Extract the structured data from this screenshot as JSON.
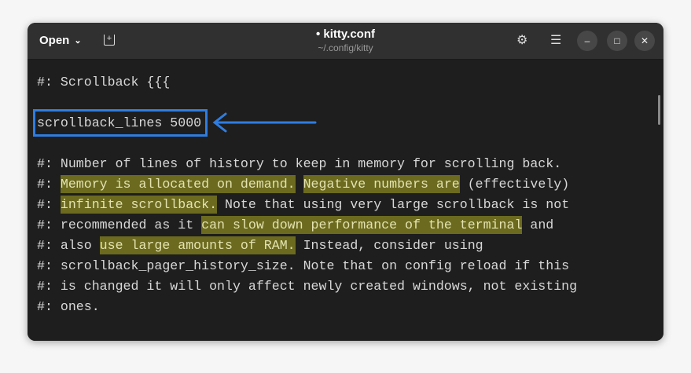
{
  "header": {
    "open_label": "Open",
    "title": "• kitty.conf",
    "subtitle": "~/.config/kitty"
  },
  "editor": {
    "lines": [
      [
        {
          "t": "#: Scrollback {{{",
          "h": false
        }
      ],
      [
        {
          "t": "scrollback_lines 5000",
          "h": false
        }
      ],
      [
        {
          "t": "#: Number of lines of history to keep in memory for scrolling back.",
          "h": false
        }
      ],
      [
        {
          "t": "#: ",
          "h": false
        },
        {
          "t": "Memory is allocated on demand.",
          "h": true
        },
        {
          "t": " ",
          "h": false
        },
        {
          "t": "Negative numbers are",
          "h": true
        },
        {
          "t": " (effectively)",
          "h": false
        }
      ],
      [
        {
          "t": "#: ",
          "h": false
        },
        {
          "t": "infinite scrollback.",
          "h": true
        },
        {
          "t": " Note that using very large scrollback is not",
          "h": false
        }
      ],
      [
        {
          "t": "#: recommended as it ",
          "h": false
        },
        {
          "t": "can slow down performance of the terminal",
          "h": true
        },
        {
          "t": " and",
          "h": false
        }
      ],
      [
        {
          "t": "#: also ",
          "h": false
        },
        {
          "t": "use large amounts of RAM.",
          "h": true
        },
        {
          "t": " Instead, consider using",
          "h": false
        }
      ],
      [
        {
          "t": "#: scrollback_pager_history_size. Note that on config reload if this",
          "h": false
        }
      ],
      [
        {
          "t": "#: is changed it will only affect newly created windows, not existing",
          "h": false
        }
      ],
      [
        {
          "t": "#: ones.",
          "h": false
        }
      ]
    ]
  },
  "colors": {
    "highlight": "#6b6a1f",
    "annotation": "#2f7de1"
  }
}
